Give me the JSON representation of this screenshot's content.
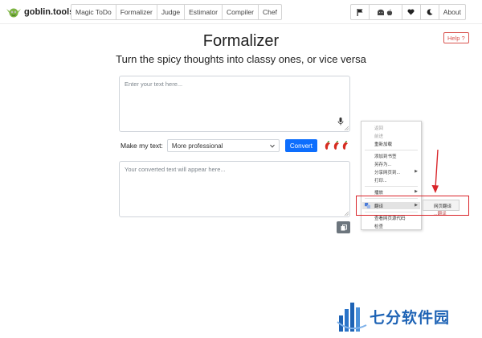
{
  "brand": {
    "name": "goblin.tools"
  },
  "nav": {
    "tools": [
      "Magic ToDo",
      "Formalizer",
      "Judge",
      "Estimator",
      "Compiler",
      "Chef"
    ],
    "right": {
      "flag_icon": "flag-icon",
      "platforms_icon": "android-apple-icon",
      "heart_icon": "heart-icon",
      "theme_icon": "moon-icon",
      "about_label": "About"
    }
  },
  "page": {
    "title": "Formalizer",
    "subtitle": "Turn the spicy thoughts into classy ones, or vice versa",
    "help_label": "Help ?"
  },
  "input": {
    "placeholder": "Enter your text here..."
  },
  "controls": {
    "make_label": "Make my text:",
    "selected_style": "More professional",
    "convert_label": "Convert",
    "spiciness_icon": "chili-pepper-icon"
  },
  "output": {
    "placeholder": "Your converted text will appear here..."
  },
  "context_menu": {
    "items": [
      {
        "label": "返回",
        "disabled": true
      },
      {
        "label": "前进",
        "disabled": true
      },
      {
        "label": "重新加载",
        "disabled": false
      },
      {
        "label": "添加到书签",
        "disabled": false
      },
      {
        "label": "另存为...",
        "disabled": false
      },
      {
        "label": "分享网页到...",
        "disabled": false,
        "submenu": true
      },
      {
        "label": "打印...",
        "disabled": false
      },
      {
        "label": "播放",
        "disabled": false,
        "submenu": true
      },
      {
        "label": "翻译",
        "disabled": false,
        "submenu": true,
        "highlighted": true
      },
      {
        "label": "查看网页源代码",
        "disabled": false
      },
      {
        "label": "检查",
        "disabled": false
      }
    ],
    "submenu_item": "网页翻译",
    "overflow_text": "...翻译"
  },
  "watermark": {
    "text": "七分软件园"
  },
  "colors": {
    "primary": "#0d6efd",
    "danger": "#d9534f",
    "annotation": "#d9252a",
    "watermark": "#1e63b5"
  }
}
